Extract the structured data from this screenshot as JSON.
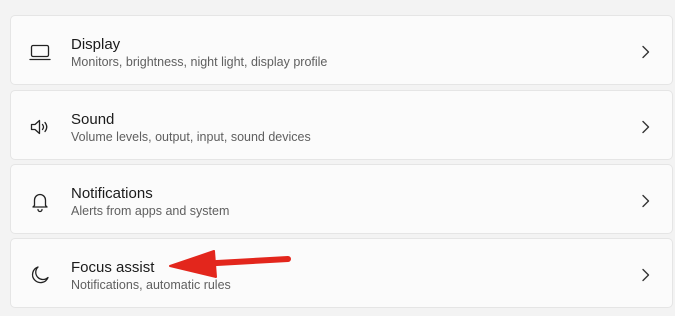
{
  "settings": {
    "items": [
      {
        "title": "Display",
        "subtitle": "Monitors, brightness, night light, display profile",
        "icon": "display-icon"
      },
      {
        "title": "Sound",
        "subtitle": "Volume levels, output, input, sound devices",
        "icon": "speaker-icon"
      },
      {
        "title": "Notifications",
        "subtitle": "Alerts from apps and system",
        "icon": "bell-icon"
      },
      {
        "title": "Focus assist",
        "subtitle": "Notifications, automatic rules",
        "icon": "moon-icon"
      }
    ]
  },
  "colors": {
    "page_background": "#f3f3f3",
    "card_background": "#fbfbfb",
    "annotation_arrow": "#e3261c"
  }
}
